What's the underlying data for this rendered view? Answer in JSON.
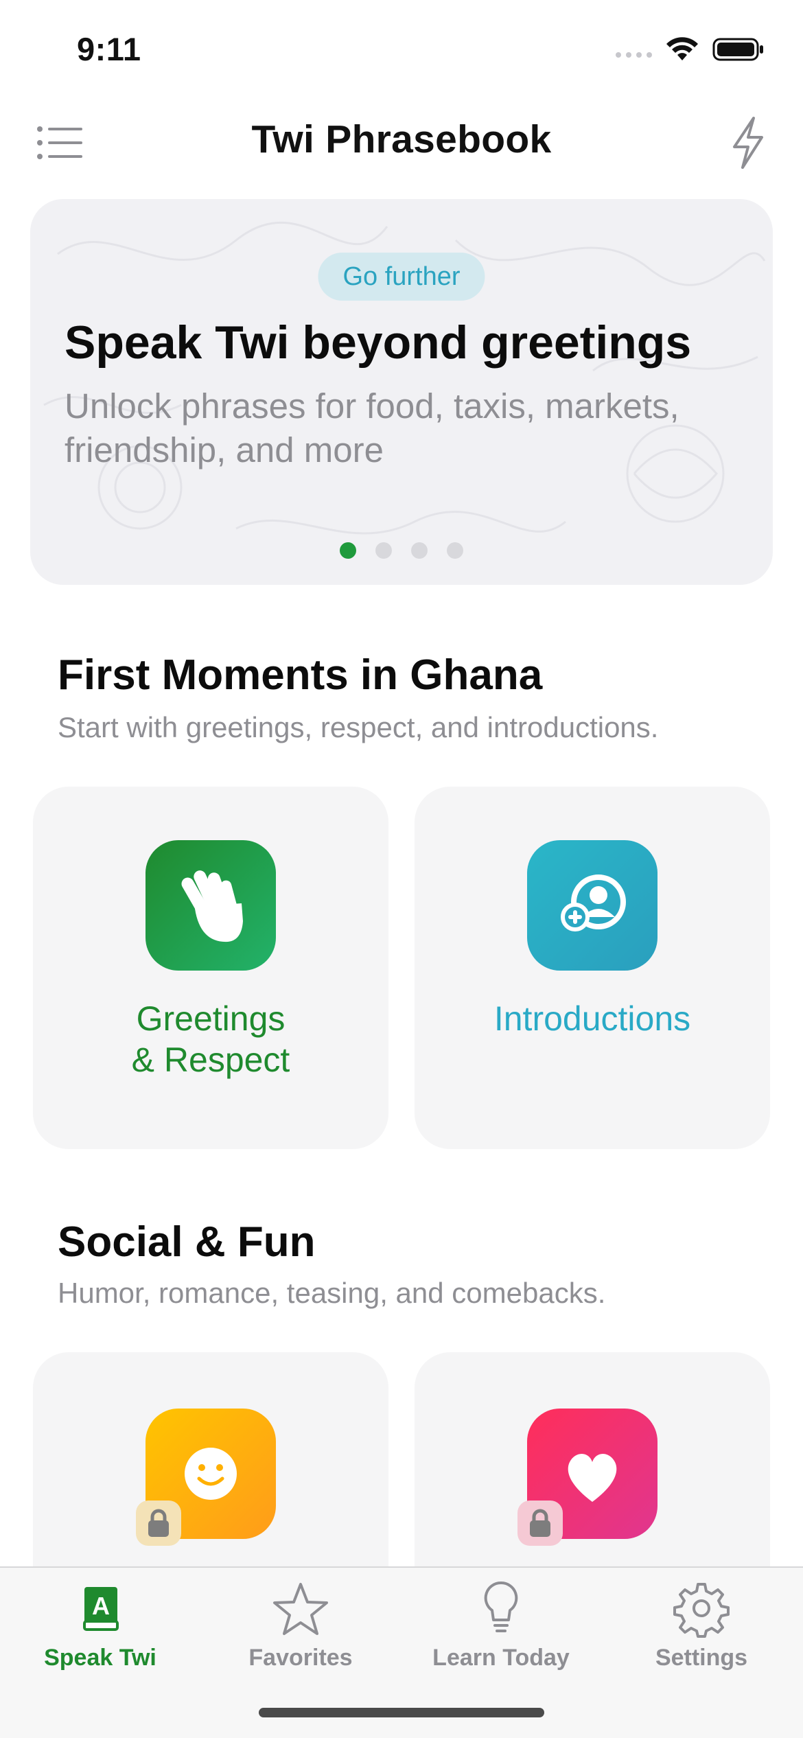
{
  "status_bar": {
    "time": "9:11"
  },
  "nav": {
    "title": "Twi Phrasebook",
    "menu_icon": "list-icon",
    "action_icon": "bolt-icon"
  },
  "promo": {
    "badge": "Go further",
    "title": "Speak Twi beyond greetings",
    "subtitle": "Unlock phrases for food, taxis, markets, friendship, and more",
    "page_count": 4,
    "active_page": 1
  },
  "sections": [
    {
      "title": "First Moments in Ghana",
      "subtitle": "Start with greetings, respect, and introductions.",
      "cards": [
        {
          "label_line1": "Greetings",
          "label_line2": "& Respect",
          "icon": "waving-hand-icon",
          "color": "#1f8a2e",
          "locked": false
        },
        {
          "label_line1": "Introductions",
          "label_line2": "",
          "icon": "person-add-icon",
          "color": "#29a9c6",
          "locked": false
        }
      ]
    },
    {
      "title": "Social & Fun",
      "subtitle": "Humor, romance, teasing, and comebacks.",
      "cards": [
        {
          "icon": "smiley-icon",
          "color": "#ffb000",
          "locked": true
        },
        {
          "icon": "heart-icon",
          "color": "#f23468",
          "locked": true
        }
      ]
    }
  ],
  "tabs": [
    {
      "label": "Speak Twi",
      "icon": "book-icon",
      "active": true
    },
    {
      "label": "Favorites",
      "icon": "star-icon",
      "active": false
    },
    {
      "label": "Learn Today",
      "icon": "lightbulb-icon",
      "active": false
    },
    {
      "label": "Settings",
      "icon": "gear-icon",
      "active": false
    }
  ],
  "colors": {
    "accent_green": "#1f8a2e",
    "accent_teal": "#29a9c6",
    "muted": "#8e8e93"
  }
}
